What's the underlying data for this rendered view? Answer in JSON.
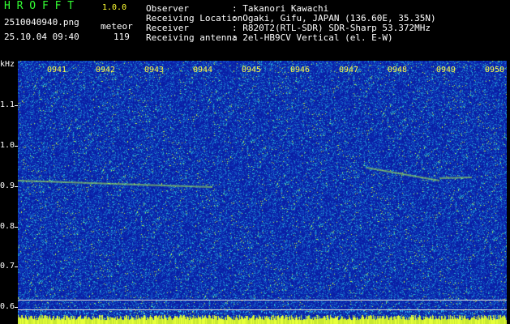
{
  "app": {
    "title": "H R O F F T",
    "version": "1.0.0"
  },
  "file": {
    "name": "2510040940.png",
    "datetime": "25.10.04 09:40"
  },
  "meteor": {
    "label": "meteor",
    "count": "119"
  },
  "info": [
    {
      "label": "Observer",
      "value": ": Takanori Kawachi"
    },
    {
      "label": "Receiving Location",
      "value": ": Ogaki, Gifu, JAPAN (136.60E, 35.35N)"
    },
    {
      "label": "Receiver",
      "value": ": R820T2(RTL-SDR) SDR-Sharp 53.372MHz"
    },
    {
      "label": "Receiving antenna",
      "value": ": 2el-HB9CV Vertical (el. E-W)"
    }
  ],
  "axis": {
    "y_unit": "kHz",
    "y_ticks": [
      "1.1",
      "1.0",
      "0.9",
      "0.8",
      "0.7",
      "0.6"
    ],
    "x_ticks": [
      "0941",
      "0942",
      "0943",
      "0944",
      "0945",
      "0946",
      "0947",
      "0948",
      "0949",
      "0950"
    ]
  },
  "colors": {
    "background": "#0a1fa8",
    "noise_low": "#1e64c8",
    "noise_mid": "#2fb4d2",
    "noise_high": "#c8ff3c",
    "trace": "#b4ff46"
  }
}
